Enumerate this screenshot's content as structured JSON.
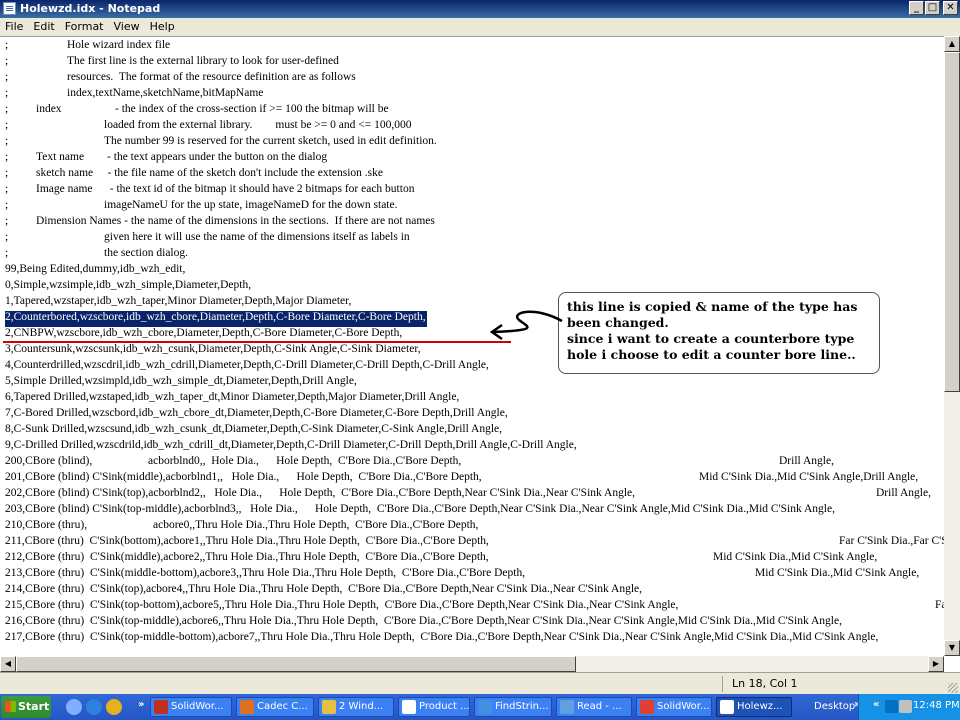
{
  "window": {
    "title": "Holewzd.idx - Notepad"
  },
  "menu": [
    "File",
    "Edit",
    "Format",
    "View",
    "Help"
  ],
  "lines": [
    [
      [
        ";",
        0
      ],
      [
        "Hole wizard index file",
        62
      ]
    ],
    [
      [
        ";",
        0
      ],
      [
        "The first line is the external library to look for user-defined",
        62
      ]
    ],
    [
      [
        ";",
        0
      ],
      [
        "resources.  The format of the resource definition are as follows",
        62
      ]
    ],
    [
      [
        ";",
        0
      ],
      [
        "index,textName,sketchName,bitMapName",
        62
      ]
    ],
    [
      [
        ";",
        0
      ],
      [
        "index",
        31
      ],
      [
        "- the index of the cross-section if >= 100 the bitmap will be",
        110
      ]
    ],
    [
      [
        ";",
        0
      ],
      [
        "loaded from the external library.        must be >= 0 and <= 100,000",
        99
      ]
    ],
    [
      [
        ";",
        0
      ],
      [
        "The number 99 is reserved for the current sketch, used in edit definition.",
        99
      ]
    ],
    [
      [
        ";",
        0
      ],
      [
        "Text name        - the text appears under the button on the dialog",
        31
      ]
    ],
    [
      [
        ";",
        0
      ],
      [
        "sketch name     - the file name of the sketch don't include the extension .ske",
        31
      ]
    ],
    [
      [
        ";",
        0
      ],
      [
        "Image name      - the text id of the bitmap it should have 2 bitmaps for each button",
        31
      ]
    ],
    [
      [
        ";",
        0
      ],
      [
        "imageNameU for the up state, imageNameD for the down state.",
        99
      ]
    ],
    [
      [
        ";",
        0
      ],
      [
        "Dimension Names - the name of the dimensions in the sections.  If there are not names",
        31
      ]
    ],
    [
      [
        ";",
        0
      ],
      [
        "given here it will use the name of the dimensions itself as labels in",
        99
      ]
    ],
    [
      [
        ";",
        0
      ],
      [
        "the section dialog.",
        99
      ]
    ],
    [
      [
        "99,Being Edited,dummy,idb_wzh_edit,",
        0
      ]
    ],
    [
      [
        "0,Simple,wzsimple,idb_wzh_simple,Diameter,Depth,",
        0
      ]
    ],
    [
      [
        "1,Tapered,wzstaper,idb_wzh_taper,Minor Diameter,Depth,Major Diameter,",
        0
      ]
    ],
    [
      [
        "2,Counterbored,wzscbore,idb_wzh_cbore,Diameter,Depth,C-Bore Diameter,C-Bore Depth,",
        0
      ]
    ],
    [
      [
        "2,CNBPW,wzscbore,idb_wzh_cbore,Diameter,Depth,C-Bore Diameter,C-Bore Depth,",
        0
      ]
    ],
    [
      [
        "3,Countersunk,wzscsunk,idb_wzh_csunk,Diameter,Depth,C-Sink Angle,C-Sink Diameter,",
        0
      ]
    ],
    [
      [
        "4,Counterdrilled,wzscdril,idb_wzh_cdrill,Diameter,Depth,C-Drill Diameter,C-Drill Depth,C-Drill Angle,",
        0
      ]
    ],
    [
      [
        "5,Simple Drilled,wzsimpld,idb_wzh_simple_dt,Diameter,Depth,Drill Angle,",
        0
      ]
    ],
    [
      [
        "6,Tapered Drilled,wzstaped,idb_wzh_taper_dt,Minor Diameter,Depth,Major Diameter,Drill Angle,",
        0
      ]
    ],
    [
      [
        "7,C-Bored Drilled,wzscbord,idb_wzh_cbore_dt,Diameter,Depth,C-Bore Diameter,C-Bore Depth,Drill Angle,",
        0
      ]
    ],
    [
      [
        "8,C-Sunk Drilled,wzscsund,idb_wzh_csunk_dt,Diameter,Depth,C-Sink Diameter,C-Sink Angle,Drill Angle,",
        0
      ]
    ],
    [
      [
        "9,C-Drilled Drilled,wzscdrild,idb_wzh_cdrill_dt,Diameter,Depth,C-Drill Diameter,C-Drill Depth,Drill Angle,C-Drill Angle,",
        0
      ]
    ],
    [
      [
        "200,CBore (blind),",
        0
      ],
      [
        "acborblnd0,,  Hole Dia.,      Hole Depth,  C'Bore Dia.,C'Bore Depth,",
        143
      ],
      [
        "Drill Angle,",
        774
      ]
    ],
    [
      [
        "201,CBore (blind) C'Sink(middle),acborblnd1,,   Hole Dia.,      Hole Depth,  C'Bore Dia.,C'Bore Depth,",
        0
      ],
      [
        "Mid C'Sink Dia.,Mid C'Sink Angle,Drill Angle,",
        694
      ]
    ],
    [
      [
        "202,CBore (blind) C'Sink(top),acborblnd2,,   Hole Dia.,      Hole Depth,  C'Bore Dia.,C'Bore Depth,Near C'Sink Dia.,Near C'Sink Angle,",
        0
      ],
      [
        "Drill Angle,",
        871
      ]
    ],
    [
      [
        "203,CBore (blind) C'Sink(top-middle),acborblnd3,,   Hole Dia.,      Hole Depth,  C'Bore Dia.,C'Bore Depth,Near C'Sink Dia.,Near C'Sink Angle,Mid C'Sink Dia.,Mid C'Sink Angle,",
        0
      ]
    ],
    [
      [
        "210,CBore (thru),",
        0
      ],
      [
        "acbore0,,Thru Hole Dia.,Thru Hole Depth,  C'Bore Dia.,C'Bore Depth,",
        148
      ]
    ],
    [
      [
        "211,CBore (thru)  C'Sink(bottom),acbore1,,Thru Hole Dia.,Thru Hole Depth,  C'Bore Dia.,C'Bore Depth,",
        0
      ],
      [
        "Far C'Sink Dia.,Far C'Sink Angle,",
        834
      ]
    ],
    [
      [
        "212,CBore (thru)  C'Sink(middle),acbore2,,Thru Hole Dia.,Thru Hole Depth,  C'Bore Dia.,C'Bore Depth,",
        0
      ],
      [
        "Mid C'Sink Dia.,Mid C'Sink Angle,",
        708
      ]
    ],
    [
      [
        "213,CBore (thru)  C'Sink(middle-bottom),acbore3,,Thru Hole Dia.,Thru Hole Depth,  C'Bore Dia.,C'Bore Depth,",
        0
      ],
      [
        "Mid C'Sink Dia.,Mid C'Sink Angle,",
        750
      ]
    ],
    [
      [
        "214,CBore (thru)  C'Sink(top),acbore4,,Thru Hole Dia.,Thru Hole Depth,  C'Bore Dia.,C'Bore Depth,Near C'Sink Dia.,Near C'Sink Angle,",
        0
      ]
    ],
    [
      [
        "215,CBore (thru)  C'Sink(top-bottom),acbore5,,Thru Hole Dia.,Thru Hole Depth,  C'Bore Dia.,C'Bore Depth,Near C'Sink Dia.,Near C'Sink Angle,",
        0
      ],
      [
        "Far C'Sink Dia.,Far C'Sink Angle,",
        930
      ]
    ],
    [
      [
        "216,CBore (thru)  C'Sink(top-middle),acbore6,,Thru Hole Dia.,Thru Hole Depth,  C'Bore Dia.,C'Bore Depth,Near C'Sink Dia.,Near C'Sink Angle,Mid C'Sink Dia.,Mid C'Sink Angle,",
        0
      ]
    ],
    [
      [
        "217,CBore (thru)  C'Sink(top-middle-bottom),acbore7,,Thru Hole Dia.,Thru Hole Depth,  C'Bore Dia.,C'Bore Depth,Near C'Sink Dia.,Near C'Sink Angle,Mid C'Sink Dia.,Mid C'Sink Angle,",
        0
      ]
    ]
  ],
  "selected_line_index": 17,
  "annotation": {
    "lines": [
      "this line is copied & name of the type has",
      "been changed.",
      "since i want to create a counterbore type",
      "hole i choose to edit a counter bore line.."
    ]
  },
  "status": {
    "cursor": "Ln 18, Col 1"
  },
  "taskbar": {
    "start_label": "Start",
    "buttons": [
      {
        "label": "SolidWor...",
        "color": "#c03020"
      },
      {
        "label": "Cadec C...",
        "color": "#e07020"
      },
      {
        "label": "2 Wind...",
        "color": "#e8c040"
      },
      {
        "label": "Product ...",
        "color": "#ffffff"
      },
      {
        "label": "FindStrin...",
        "color": "#4090e0"
      },
      {
        "label": "Read - ...",
        "color": "#60a0e0"
      },
      {
        "label": "SolidWor...",
        "color": "#e04030"
      },
      {
        "label": "Holewz...",
        "color": "#ffffff"
      }
    ],
    "desktop_label": "Desktop",
    "clock": "12:48 PM"
  },
  "colors": {
    "titlebar": "#0a246a",
    "selection": "#0a246a",
    "underline": "#d00000",
    "taskbar": "#2457c5",
    "start": "#3c9b3c"
  }
}
